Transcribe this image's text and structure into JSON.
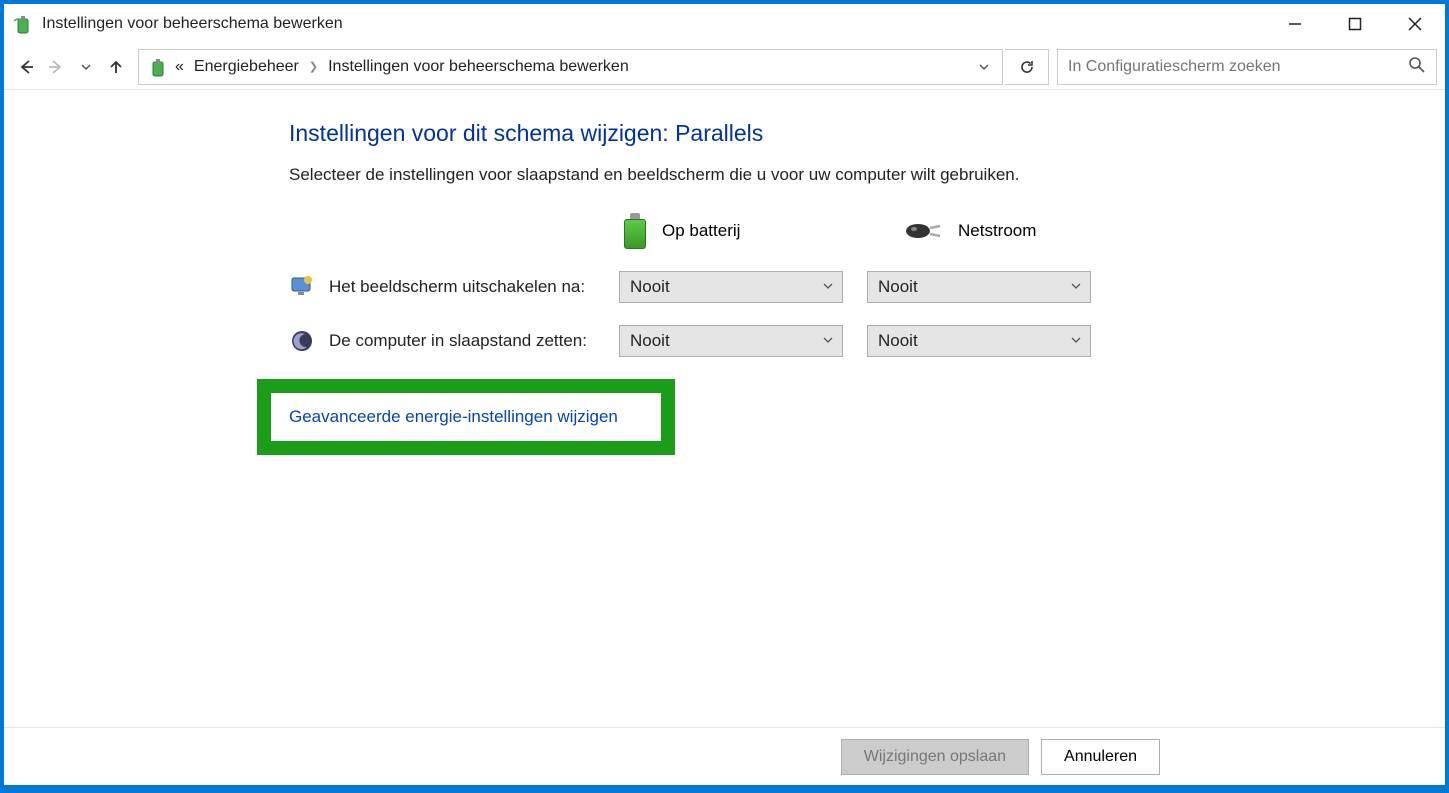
{
  "window": {
    "title": "Instellingen voor beheerschema bewerken"
  },
  "breadcrumb": {
    "root_prefix": "«",
    "item1": "Energiebeheer",
    "item2": "Instellingen voor beheerschema bewerken"
  },
  "search": {
    "placeholder": "In Configuratiescherm zoeken"
  },
  "page": {
    "title": "Instellingen voor dit schema wijzigen: Parallels",
    "subtitle": "Selecteer de instellingen voor slaapstand en beeldscherm die u voor uw computer wilt gebruiken."
  },
  "columns": {
    "battery": "Op batterij",
    "ac": "Netstroom"
  },
  "settings": {
    "display_off": {
      "label": "Het beeldscherm uitschakelen na:",
      "battery_value": "Nooit",
      "ac_value": "Nooit"
    },
    "sleep": {
      "label": "De computer in slaapstand zetten:",
      "battery_value": "Nooit",
      "ac_value": "Nooit"
    }
  },
  "links": {
    "advanced": "Geavanceerde energie-instellingen wijzigen"
  },
  "buttons": {
    "save": "Wijzigingen opslaan",
    "cancel": "Annuleren"
  },
  "colors": {
    "accent_blue": "#003399",
    "link_blue": "#0645ad",
    "highlight_green": "#1a9e1a"
  }
}
